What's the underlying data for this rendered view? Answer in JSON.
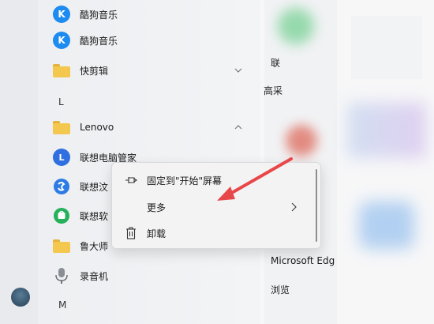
{
  "app_list": [
    {
      "type": "app",
      "label": "酷狗音乐",
      "icon": "kugou-icon"
    },
    {
      "type": "app",
      "label": "酷狗音乐",
      "icon": "kugou-icon"
    },
    {
      "type": "folder",
      "label": "快剪辑",
      "icon": "folder-icon",
      "expanded": false
    },
    {
      "type": "letter",
      "label": "L"
    },
    {
      "type": "folder",
      "label": "Lenovo",
      "icon": "folder-icon",
      "expanded": true
    },
    {
      "type": "app",
      "label": "联想电脑管家",
      "icon": "lenovo-manager-icon"
    },
    {
      "type": "app",
      "label": "联想汶",
      "icon": "lenovo-app-icon"
    },
    {
      "type": "app",
      "label": "联想软",
      "icon": "lenovo-store-icon"
    },
    {
      "type": "folder",
      "label": "鲁大师",
      "icon": "folder-icon"
    },
    {
      "type": "app",
      "label": "录音机",
      "icon": "microphone-icon"
    },
    {
      "type": "letter",
      "label": "M"
    }
  ],
  "tiles": {
    "tile1_label": "联",
    "tile2_label": "高采",
    "tile3_label": "Microsoft Edg",
    "tile4_label": "浏览"
  },
  "context_menu": {
    "items": [
      {
        "label": "固定到\"开始\"屏幕",
        "icon": "pin-icon"
      },
      {
        "label": "更多",
        "icon": "",
        "has_submenu": true
      },
      {
        "label": "卸载",
        "icon": "trash-icon"
      }
    ]
  },
  "colors": {
    "kugou_blue": "#1e8bf1",
    "folder_yellow": "#f4c84e",
    "arrow_red": "#e8474a"
  }
}
